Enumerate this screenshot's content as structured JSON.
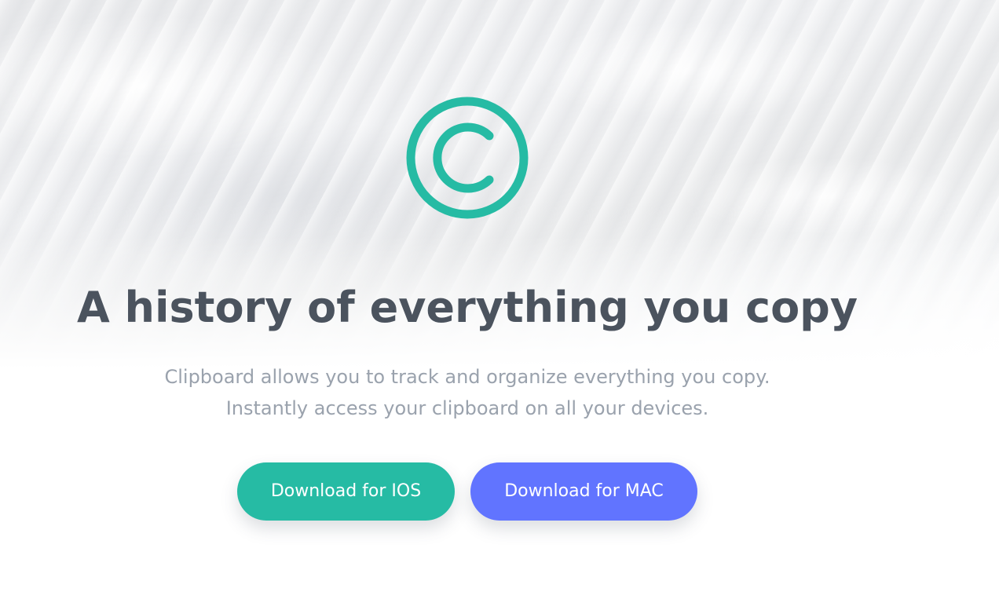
{
  "hero": {
    "logo_icon": "clipboard-c-logo-icon",
    "headline": "A history of everything you copy",
    "subtitle_lines": [
      "Clipboard allows you to track and organize everything you copy.",
      "Instantly access your clipboard on all your devices."
    ]
  },
  "actions": {
    "ios_label": "Download for IOS",
    "mac_label": "Download for MAC"
  },
  "colors": {
    "accent_teal": "#26bba4",
    "accent_indigo": "#6174ff",
    "heading_text": "#4b535e",
    "body_text": "#9aa2ad"
  }
}
